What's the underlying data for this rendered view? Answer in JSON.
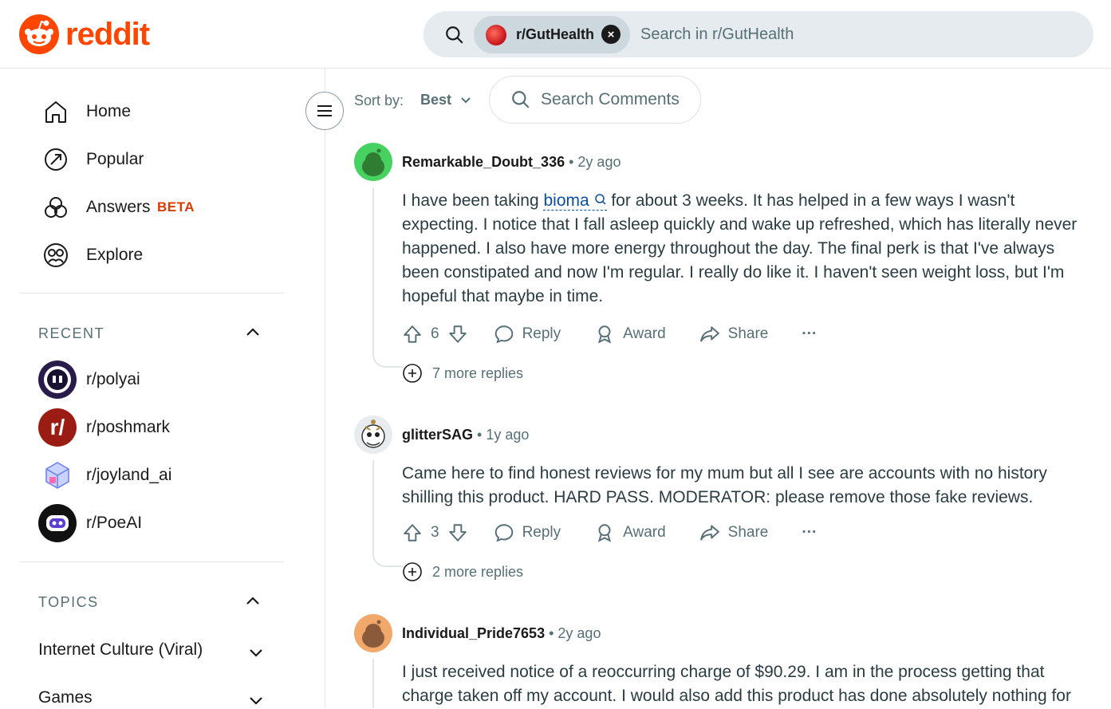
{
  "header": {
    "logo_text": "reddit",
    "search_chip": "r/GutHealth",
    "search_placeholder": "Search in r/GutHealth"
  },
  "sidebar": {
    "nav": [
      {
        "label": "Home",
        "icon": "home-icon"
      },
      {
        "label": "Popular",
        "icon": "popular-icon"
      },
      {
        "label": "Answers",
        "icon": "answers-icon",
        "badge": "BETA"
      },
      {
        "label": "Explore",
        "icon": "explore-icon"
      }
    ],
    "recent_title": "RECENT",
    "recent": [
      {
        "label": "r/polyai",
        "color": "#2a1b4d"
      },
      {
        "label": "r/poshmark",
        "color": "#9b1c12"
      },
      {
        "label": "r/joyland_ai",
        "color": "#ffffff"
      },
      {
        "label": "r/PoeAI",
        "color": "#111111"
      }
    ],
    "topics_title": "TOPICS",
    "topics": [
      {
        "label": "Internet Culture (Viral)"
      },
      {
        "label": "Games"
      }
    ]
  },
  "toolbar": {
    "sort_label": "Sort by:",
    "sort_value": "Best",
    "search_comments": "Search Comments"
  },
  "comments": [
    {
      "author": "Remarkable_Doubt_336",
      "time": "2y ago",
      "body_before": "I have been taking ",
      "body_link": "bioma",
      "body_after": " for about 3 weeks. It has helped in a few ways I wasn't expecting. I notice that I fall asleep quickly and wake up refreshed, which has literally never happened. I also have more energy throughout the day. The final perk is that I've always been constipated and now I'm regular. I really do like it. I haven't seen weight loss, but I'm hopeful that maybe in time.",
      "votes": "6",
      "more_replies": "7 more replies",
      "avatar_color": "#46d160"
    },
    {
      "author": "glitterSAG",
      "time": "1y ago",
      "body": "Came here to find honest reviews for my mum but all I see are accounts with no history shilling this product. HARD PASS. MODERATOR: please remove those fake reviews.",
      "votes": "3",
      "more_replies": "2 more replies",
      "avatar_color": "#e8ecef"
    },
    {
      "author": "Individual_Pride7653",
      "time": "2y ago",
      "body": "I just received notice of a reoccurring charge of $90.29. I am in the process getting that charge taken off my account. I would also add this product has done absolutely nothing for",
      "avatar_color": "#f2a86b"
    }
  ],
  "actions": {
    "reply": "Reply",
    "award": "Award",
    "share": "Share",
    "more": "···"
  }
}
